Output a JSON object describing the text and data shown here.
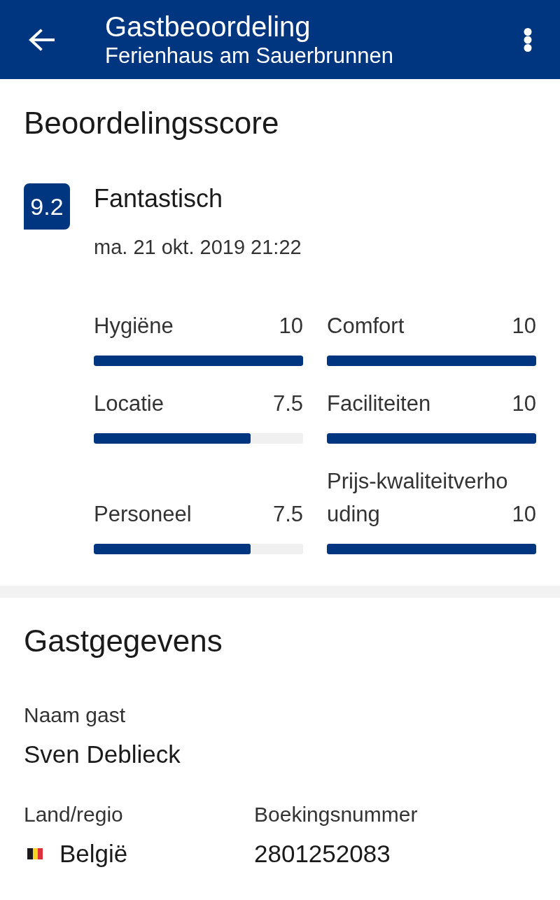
{
  "app_bar": {
    "title": "Gastbeoordeling",
    "subtitle": "Ferienhaus am Sauerbrunnen"
  },
  "score_section": {
    "heading": "Beoordelingsscore",
    "score": "9.2",
    "verdict": "Fantastisch",
    "date": "ma. 21 okt. 2019 21:22",
    "categories": [
      {
        "label": "Hygiëne",
        "score": "10",
        "level": 1
      },
      {
        "label": "Locatie",
        "score": "7.5",
        "level": 0.75
      },
      {
        "label": "Personeel",
        "score": "7.5",
        "level": 0.75
      },
      {
        "label": "Comfort",
        "score": "10",
        "level": 1
      },
      {
        "label": "Faciliteiten",
        "score": "10",
        "level": 1
      },
      {
        "label": "Prijs-kwaliteitverhouding",
        "score": "10",
        "level": 1
      }
    ]
  },
  "guest_section": {
    "heading": "Gastgegevens",
    "rows": [
      [
        {
          "kind": "text",
          "label": "Naam gast",
          "value": "Sven Deblieck"
        }
      ],
      [
        {
          "kind": "country",
          "label": "Land/regio",
          "value": "België"
        },
        {
          "kind": "text",
          "label": "Boekingsnummer",
          "value": "2801252083"
        }
      ]
    ]
  }
}
